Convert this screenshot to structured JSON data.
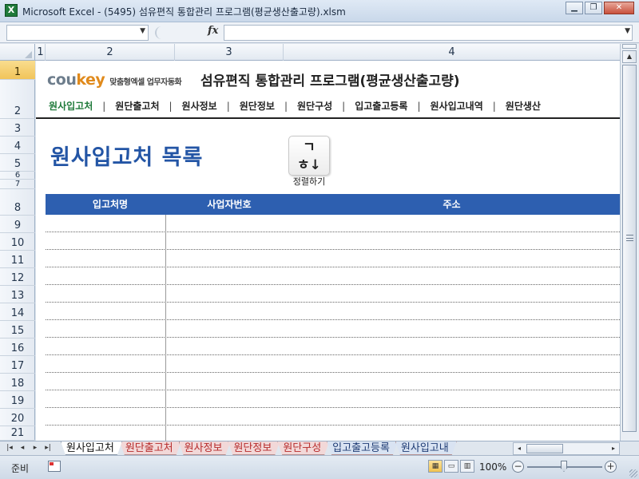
{
  "window": {
    "title": "Microsoft Excel - (5495) 섬유편직 통합관리 프로그램(평균생산출고량).xlsm",
    "app_icon": "X"
  },
  "formula_bar": {
    "name_box_value": "",
    "fx_label": "fx",
    "formula_value": ""
  },
  "columns": [
    "1",
    "2",
    "3",
    "4"
  ],
  "rows": [
    "1",
    "2",
    "3",
    "4",
    "5",
    "6",
    "7",
    "8",
    "9",
    "10",
    "11",
    "12",
    "13",
    "14",
    "15",
    "16",
    "17",
    "18",
    "19",
    "20",
    "21"
  ],
  "sheet": {
    "brand_logo_left": "cou",
    "brand_logo_right": "key",
    "brand_tagline": "맞춤형엑셀 업무자동화",
    "program_title": "섬유편직 통합관리 프로그램(평균생산출고량)",
    "nav_tabs": [
      "원사입고처",
      "원단출고처",
      "원사정보",
      "원단정보",
      "원단구성",
      "입고출고등록",
      "원사입고내역",
      "원단생산"
    ],
    "page_heading": "원사입고처 목록",
    "sort_button": {
      "icon": "ㄱ\nㅎ↓",
      "label": "정렬하기"
    },
    "table_headers": [
      "입고처명",
      "사업자번호",
      "주소"
    ]
  },
  "sheet_tabs": [
    "원사입고처",
    "원단출고처",
    "원사정보",
    "원단정보",
    "원단구성",
    "입고출고등록",
    "원사입고내"
  ],
  "status": {
    "ready_text": "준비",
    "zoom": "100%"
  },
  "colors": {
    "heading_blue": "#2355a5",
    "table_header_bg": "#2d5fb0",
    "active_nav": "#1f7a3a",
    "sheet_tab_red": "#b62c2c"
  }
}
